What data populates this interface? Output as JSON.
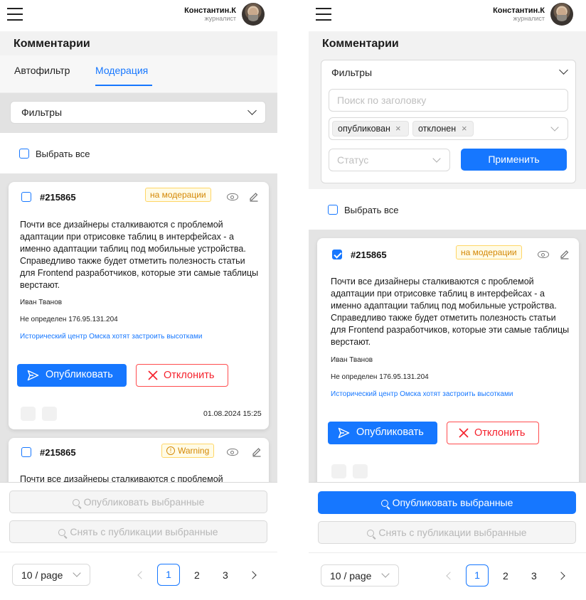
{
  "header": {
    "user_name": "Константин.К",
    "user_role": "журналист"
  },
  "page_title": "Комментарии",
  "tabs": [
    {
      "label": "Автофильтр"
    },
    {
      "label": "Модерация"
    }
  ],
  "filters": {
    "label": "Фильтры",
    "search_placeholder": "Поиск по заголовку",
    "tags": [
      "опубликован",
      "отклонен"
    ],
    "status_placeholder": "Статус",
    "apply_label": "Применить"
  },
  "select_all_label": "Выбрать все",
  "cards": [
    {
      "id": "#215865",
      "badge": "на модерации",
      "text": "Почти все дизайнеры сталкиваются с проблемой адаптации при отрисовке таблиц в интерфейсах - а именно адаптации таблиц под мобильные устройства. Справедливо также будет отметить полезность статьи для Frontend разработчиков, которые эти самые таблицы верстают.",
      "author": "Иван Тванов",
      "ip": "Не определен 176.95.131.204",
      "link": "Исторический центр Омска хотят застроить высотками",
      "publish": "Опубликовать",
      "reject": "Отклонить",
      "date": "01.08.2024 15:25"
    },
    {
      "id": "#215865",
      "badge": "Warning",
      "text": "Почти все дизайнеры сталкиваются с проблемой"
    }
  ],
  "bulk": {
    "publish_selected": "Опубликовать выбранные",
    "unpublish_selected": "Снять с публикации выбранные"
  },
  "pagination": {
    "page_size": "10 / page",
    "pages": [
      "1",
      "2",
      "3"
    ],
    "current": "1"
  },
  "colors": {
    "primary": "#1677ff",
    "danger": "#ff4d4f",
    "warning": "#d48806"
  }
}
